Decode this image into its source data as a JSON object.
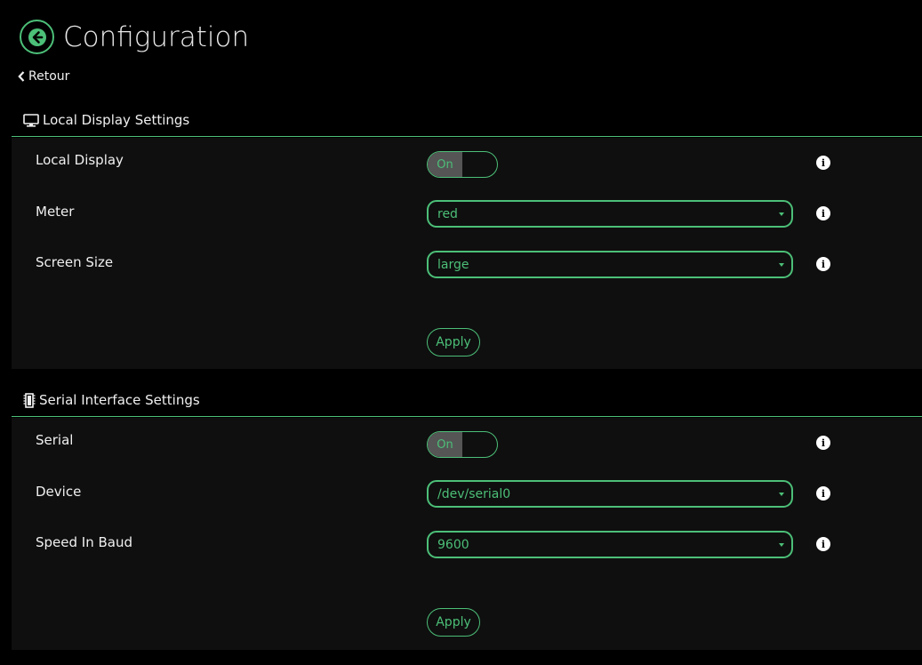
{
  "header": {
    "title": "Configuration",
    "back_link": "Retour"
  },
  "colors": {
    "accent": "#4cbf78",
    "background": "#000000",
    "panel": "#0f0f0f",
    "toggle_on_bg": "#555555"
  },
  "local_display": {
    "title": "Local Display Settings",
    "icon": "monitor-icon",
    "rows": {
      "local_display": {
        "label": "Local Display",
        "toggle": "On"
      },
      "meter": {
        "label": "Meter",
        "value": "red"
      },
      "screen_size": {
        "label": "Screen Size",
        "value": "large"
      }
    },
    "apply_label": "Apply"
  },
  "serial_interface": {
    "title": "Serial Interface Settings",
    "icon": "chip-icon",
    "rows": {
      "serial": {
        "label": "Serial",
        "toggle": "On"
      },
      "device": {
        "label": "Device",
        "value": "/dev/serial0"
      },
      "speed": {
        "label": "Speed In Baud",
        "value": "9600"
      }
    },
    "apply_label": "Apply"
  }
}
